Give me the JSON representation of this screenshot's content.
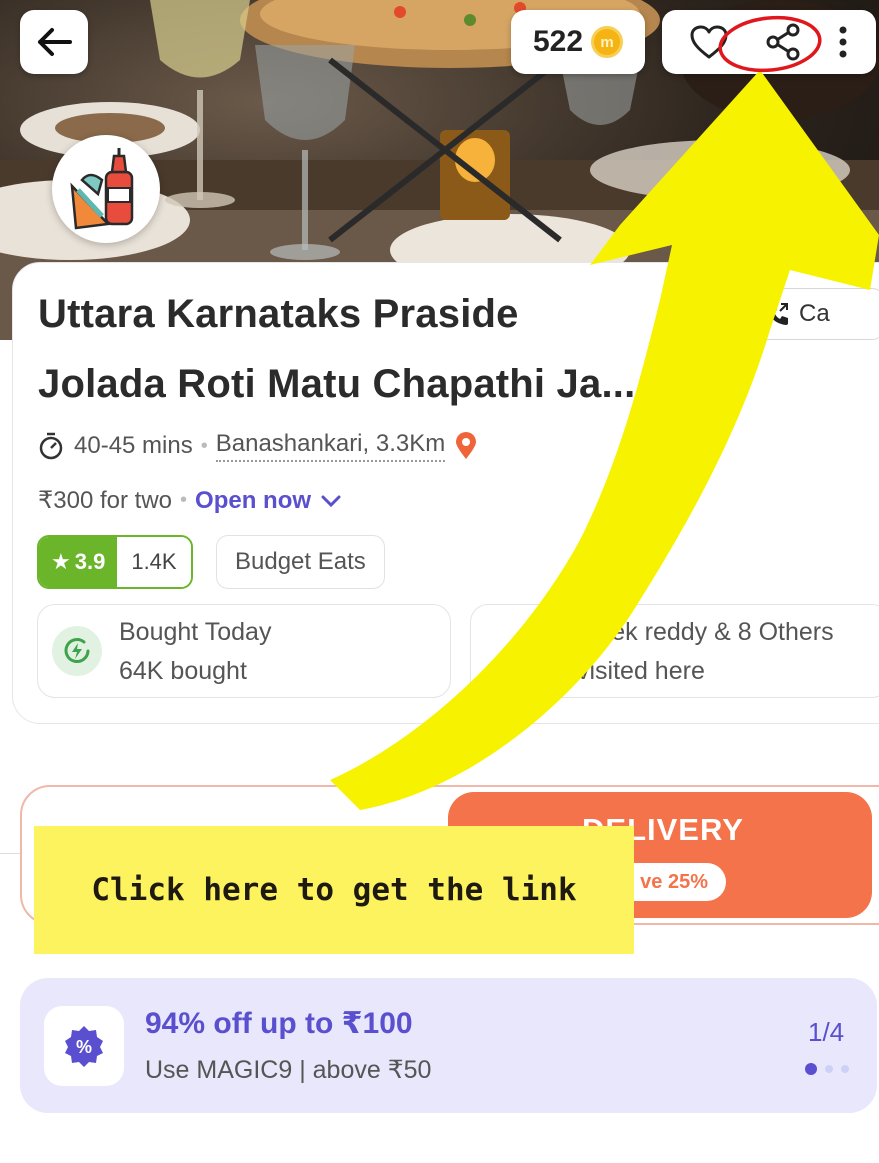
{
  "header": {
    "back_icon": "arrow-left-icon",
    "coins": "522",
    "coin_symbol": "m",
    "coin_icon": "coin-icon",
    "favorite_icon": "heart-icon",
    "share_icon": "share-icon",
    "more_icon": "more-vertical-icon"
  },
  "restaurant": {
    "logo_icon": "fastfood-logo-icon",
    "name_line1": "Uttara Karnataks Praside",
    "name_line2": "Jolada Roti Matu Chapathi Ja...",
    "call_label": "Ca",
    "call_icon": "phone-icon",
    "time": "40-45 mins",
    "time_icon": "timer-icon",
    "location": "Banashankari, 3.3Km",
    "location_icon": "location-pin-icon",
    "price": "₹300 for two",
    "status": "Open now",
    "status_icon": "chevron-down-icon",
    "rating": "3.9",
    "rating_icon": "star-icon",
    "rating_count": "1.4K",
    "tag": "Budget Eats"
  },
  "stats": [
    {
      "title": "Bought Today",
      "value": "64K bought",
      "icon": "lightning-icon"
    },
    {
      "badge": "8",
      "title": "Vivek reddy & 8 Others",
      "value": "visited here"
    }
  ],
  "mode": {
    "delivery_label": "DELIVERY",
    "save_label": "ve 25%"
  },
  "annotation": {
    "note": "Click here to get the link",
    "colors": {
      "note_bg": "#fdf35e",
      "arrow": "#f7f200",
      "circle": "#e0181e"
    }
  },
  "offer": {
    "icon": "discount-badge-icon",
    "icon_text": "%",
    "title": "94% off up to ₹100",
    "subtitle": "Use MAGIC9 | above ₹50",
    "page": "1/4"
  },
  "colors": {
    "accent": "#5a4fcf",
    "rating_green": "#6bb52a",
    "delivery_orange": "#f4734a"
  }
}
